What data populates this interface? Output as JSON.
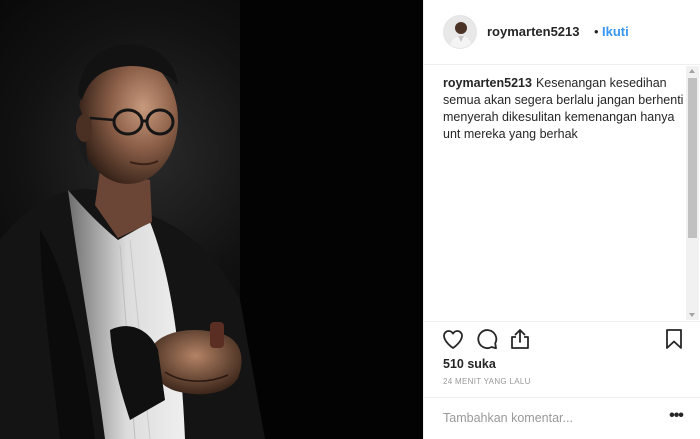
{
  "post": {
    "username": "roymarten5213",
    "separator": "•",
    "follow_label": "Ikuti",
    "caption_username": "roymarten5213",
    "caption_text": "Kesenangan kesedihan semua akan segera berlalu jangan berhenti menyerah dikesulitan kemenangan hanya unt mereka yang berhak",
    "likes": "510 suka",
    "timestamp": "24 MENIT YANG LALU",
    "comment_placeholder": "Tambahkan komentar...",
    "more_label": "•••"
  },
  "icons": {
    "like": "heart-icon",
    "comment": "comment-icon",
    "share": "share-icon",
    "save": "bookmark-icon",
    "more": "more-options-icon"
  },
  "colors": {
    "accent": "#3897f0",
    "text": "#262626",
    "muted": "#999999",
    "border": "#efefef"
  }
}
